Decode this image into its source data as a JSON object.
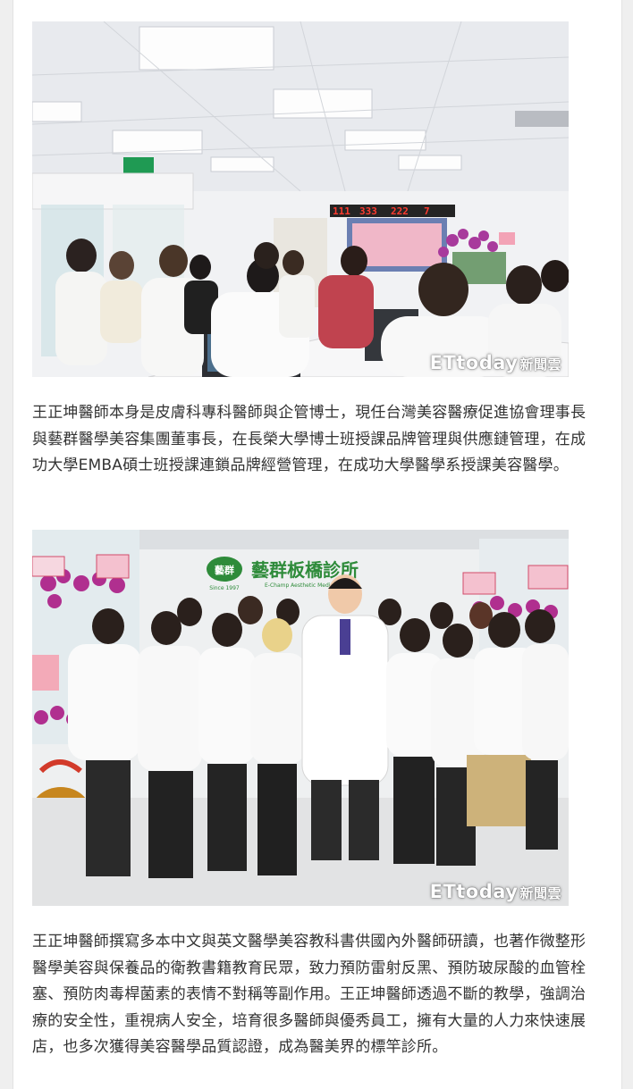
{
  "article": {
    "photo1": {
      "description_alt": "",
      "watermark_brand": "ETtoday",
      "watermark_sub": "新聞雲",
      "counter": [
        "111",
        "333",
        "222",
        "7"
      ]
    },
    "paragraph1": "王正坤醫師本身是皮膚科專科醫師與企管博士，現任台灣美容醫療促進協會理事長與藝群醫學美容集團董事長，在長榮大學博士班授課品牌管理與供應鏈管理，在成功大學EMBA碩士班授課連鎖品牌經營管理，在成功大學醫學系授課美容醫學。",
    "photo2": {
      "clinic_sign": "藝群板橋診所",
      "clinic_sign_en": "E-Champ Aesthetic Medical",
      "logo_text": "藝群",
      "since": "Since 1997",
      "watermark_brand": "ETtoday",
      "watermark_sub": "新聞雲"
    },
    "paragraph2": "王正坤醫師撰寫多本中文與英文醫學美容教科書供國內外醫師研讀，也著作微整形醫學美容與保養品的衛教書籍教育民眾，致力預防雷射反黑、預防玻尿酸的血管栓塞、預防肉毒桿菌素的表情不對稱等副作用。王正坤醫師透過不斷的教學，強調治療的安全性，重視病人安全，培育很多醫師與優秀員工，擁有大量的人力來快速展店，也多次獲得美容醫學品質認證，成為醫美界的標竿診所。"
  }
}
